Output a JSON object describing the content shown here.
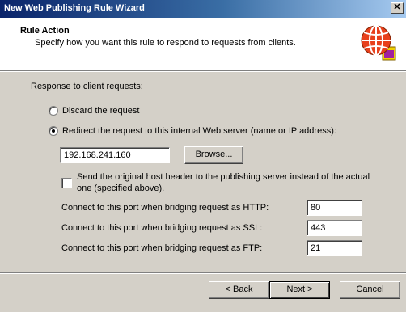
{
  "window": {
    "title": "New Web Publishing Rule Wizard",
    "close_label": "✕"
  },
  "header": {
    "title": "Rule Action",
    "subtitle": "Specify how you want this rule to respond to requests from clients."
  },
  "main": {
    "section_label": "Response to client requests:",
    "option_discard": "Discard the request",
    "option_redirect": "Redirect the request to this internal Web server (name or IP address):",
    "server_value": "192.168.241.160",
    "browse_label": "Browse...",
    "host_header_line1": "Send the original host header to the publishing server instead of the actual",
    "host_header_line2": "one (specified above).",
    "http_label": "Connect to this port when bridging request as HTTP:",
    "http_value": "80",
    "ssl_label": "Connect to this port when bridging request as SSL:",
    "ssl_value": "443",
    "ftp_label": "Connect to this port when bridging request as FTP:",
    "ftp_value": "21"
  },
  "footer": {
    "back_label": "< Back",
    "next_label": "Next >",
    "cancel_label": "Cancel"
  }
}
